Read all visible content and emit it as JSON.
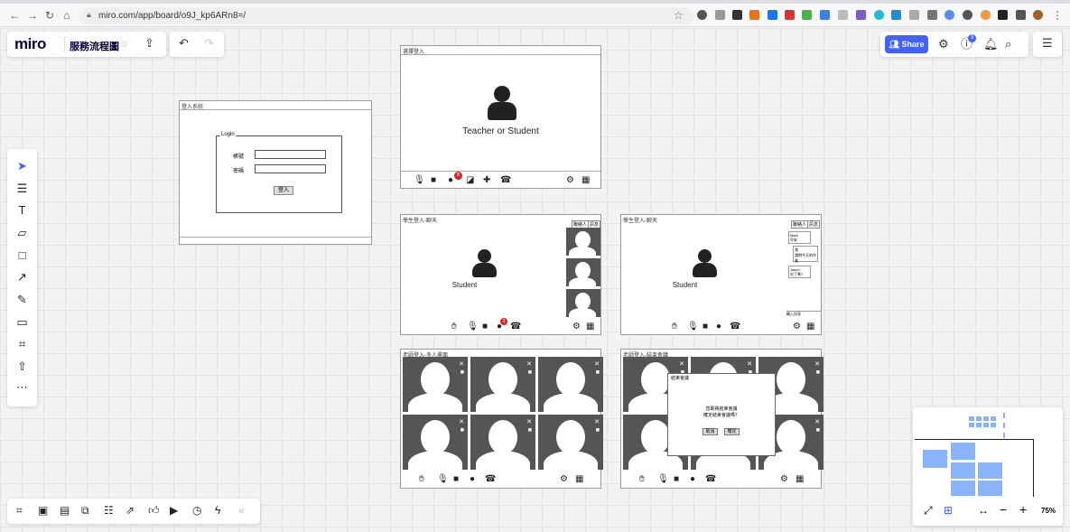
{
  "browser": {
    "url": "miro.com/app/board/o9J_kp6ARn8=/"
  },
  "app": {
    "logo": "miro",
    "board_name": "服務流程圖",
    "share_label": "Share",
    "help_badge": "3",
    "zoom": "75%"
  },
  "frames": {
    "login": {
      "title": "登入系統",
      "group": "Login",
      "account_label": "帳號",
      "password_label": "密碼",
      "submit_label": "登入"
    },
    "role": {
      "title": "選擇登入",
      "prompt": "Teacher or Student",
      "chat_badge": "8"
    },
    "student_a": {
      "title": "學生登入-聊天",
      "label": "Student",
      "tab1": "聯絡人",
      "tab2": "訊息",
      "chat_badge": "3"
    },
    "student_b": {
      "title": "學生登入-聊天",
      "label": "Student",
      "tab1": "聯絡人",
      "tab2": "訊息",
      "msg1_name": "Mark",
      "msg1_text": "早安",
      "msg2_name": "我",
      "msg2_text": "請問今天的作業",
      "msg3_name": "Jason",
      "msg3_text": "交了嗎?",
      "input_placeholder": "輸入訊息"
    },
    "teacher_a": {
      "title": "老師登入-多人畫面"
    },
    "teacher_b": {
      "title": "老師登入-結束會議",
      "dialog_title": "結束會議",
      "dialog_line1": "您即將結束會議",
      "dialog_line2": "確定結束會議嗎？",
      "cancel": "取消",
      "confirm": "確定"
    }
  }
}
